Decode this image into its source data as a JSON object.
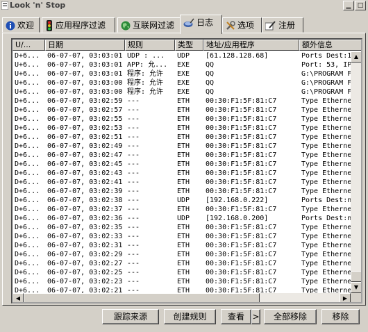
{
  "window": {
    "title": "Look 'n' Stop",
    "controls": [
      "minimize",
      "maximize"
    ]
  },
  "tabs": [
    {
      "label": "欢迎",
      "icon": "info-icon",
      "active": false
    },
    {
      "label": "应用程序过滤",
      "icon": "traffic-light-icon",
      "active": false
    },
    {
      "label": "互联网过滤",
      "icon": "globe-icon",
      "active": false
    },
    {
      "label": "日志",
      "icon": "log-icon",
      "active": true
    },
    {
      "label": "选项",
      "icon": "tools-icon",
      "active": false
    },
    {
      "label": "注册",
      "icon": "pen-icon",
      "active": false
    }
  ],
  "log_table": {
    "columns": [
      "U/...",
      "日期",
      "规则",
      "类型",
      "地址/应用程序",
      "额外信息"
    ],
    "rows": [
      [
        "D+6...",
        "06-07-07, 03:03:01",
        "UDP : ...",
        "UDP",
        "[61.128.128.68]",
        "Ports Dest:1"
      ],
      [
        "U+6...",
        "06-07-07, 03:03:01",
        "APP: 允...",
        "EXE",
        "QQ",
        "Port: 53, IP"
      ],
      [
        "U+6...",
        "06-07-07, 03:03:01",
        "程序: 允许",
        "EXE",
        "QQ",
        "G:\\PROGRAM F"
      ],
      [
        "U+6...",
        "06-07-07, 03:03:00",
        "程序: 允许",
        "EXE",
        "QQ",
        "G:\\PROGRAM F"
      ],
      [
        "U+6...",
        "06-07-07, 03:03:00",
        "程序: 允许",
        "EXE",
        "QQ",
        "G:\\PROGRAM F"
      ],
      [
        "D+6...",
        "06-07-07, 03:02:59",
        "---",
        "ETH",
        "00:30:F1:5F:81:C7",
        "Type Etherne"
      ],
      [
        "D+6...",
        "06-07-07, 03:02:57",
        "---",
        "ETH",
        "00:30:F1:5F:81:C7",
        "Type Etherne"
      ],
      [
        "D+6...",
        "06-07-07, 03:02:55",
        "---",
        "ETH",
        "00:30:F1:5F:81:C7",
        "Type Etherne"
      ],
      [
        "D+6...",
        "06-07-07, 03:02:53",
        "---",
        "ETH",
        "00:30:F1:5F:81:C7",
        "Type Etherne"
      ],
      [
        "D+6...",
        "06-07-07, 03:02:51",
        "---",
        "ETH",
        "00:30:F1:5F:81:C7",
        "Type Etherne"
      ],
      [
        "D+6...",
        "06-07-07, 03:02:49",
        "---",
        "ETH",
        "00:30:F1:5F:81:C7",
        "Type Etherne"
      ],
      [
        "D+6...",
        "06-07-07, 03:02:47",
        "---",
        "ETH",
        "00:30:F1:5F:81:C7",
        "Type Etherne"
      ],
      [
        "D+6...",
        "06-07-07, 03:02:45",
        "---",
        "ETH",
        "00:30:F1:5F:81:C7",
        "Type Etherne"
      ],
      [
        "D+6...",
        "06-07-07, 03:02:43",
        "---",
        "ETH",
        "00:30:F1:5F:81:C7",
        "Type Etherne"
      ],
      [
        "D+6...",
        "06-07-07, 03:02:41",
        "---",
        "ETH",
        "00:30:F1:5F:81:C7",
        "Type Etherne"
      ],
      [
        "D+6...",
        "06-07-07, 03:02:39",
        "---",
        "ETH",
        "00:30:F1:5F:81:C7",
        "Type Etherne"
      ],
      [
        "D+6...",
        "06-07-07, 03:02:38",
        "---",
        "UDP",
        "[192.168.0.222]",
        "Ports Dest:n"
      ],
      [
        "D+6...",
        "06-07-07, 03:02:37",
        "---",
        "ETH",
        "00:30:F1:5F:81:C7",
        "Type Etherne"
      ],
      [
        "D+6...",
        "06-07-07, 03:02:36",
        "---",
        "UDP",
        "[192.168.0.200]",
        "Ports Dest:n"
      ],
      [
        "D+6...",
        "06-07-07, 03:02:35",
        "---",
        "ETH",
        "00:30:F1:5F:81:C7",
        "Type Etherne"
      ],
      [
        "D+6...",
        "06-07-07, 03:02:33",
        "---",
        "ETH",
        "00:30:F1:5F:81:C7",
        "Type Etherne"
      ],
      [
        "D+6...",
        "06-07-07, 03:02:31",
        "---",
        "ETH",
        "00:30:F1:5F:81:C7",
        "Type Etherne"
      ],
      [
        "D+6...",
        "06-07-07, 03:02:29",
        "---",
        "ETH",
        "00:30:F1:5F:81:C7",
        "Type Etherne"
      ],
      [
        "D+6...",
        "06-07-07, 03:02:27",
        "---",
        "ETH",
        "00:30:F1:5F:81:C7",
        "Type Etherne"
      ],
      [
        "D+6...",
        "06-07-07, 03:02:25",
        "---",
        "ETH",
        "00:30:F1:5F:81:C7",
        "Type Etherne"
      ],
      [
        "D+6...",
        "06-07-07, 03:02:23",
        "---",
        "ETH",
        "00:30:F1:5F:81:C7",
        "Type Etherne"
      ],
      [
        "D+6...",
        "06-07-07, 03:02:21",
        "---",
        "ETH",
        "00:30:F1:5F:81:C7",
        "Type Etherne"
      ]
    ]
  },
  "buttons": {
    "trace": "跟踪来源",
    "create_rule": "创建规则",
    "view": "查看",
    "view_arrow": ">",
    "remove_all": "全部移除",
    "remove": "移除"
  }
}
